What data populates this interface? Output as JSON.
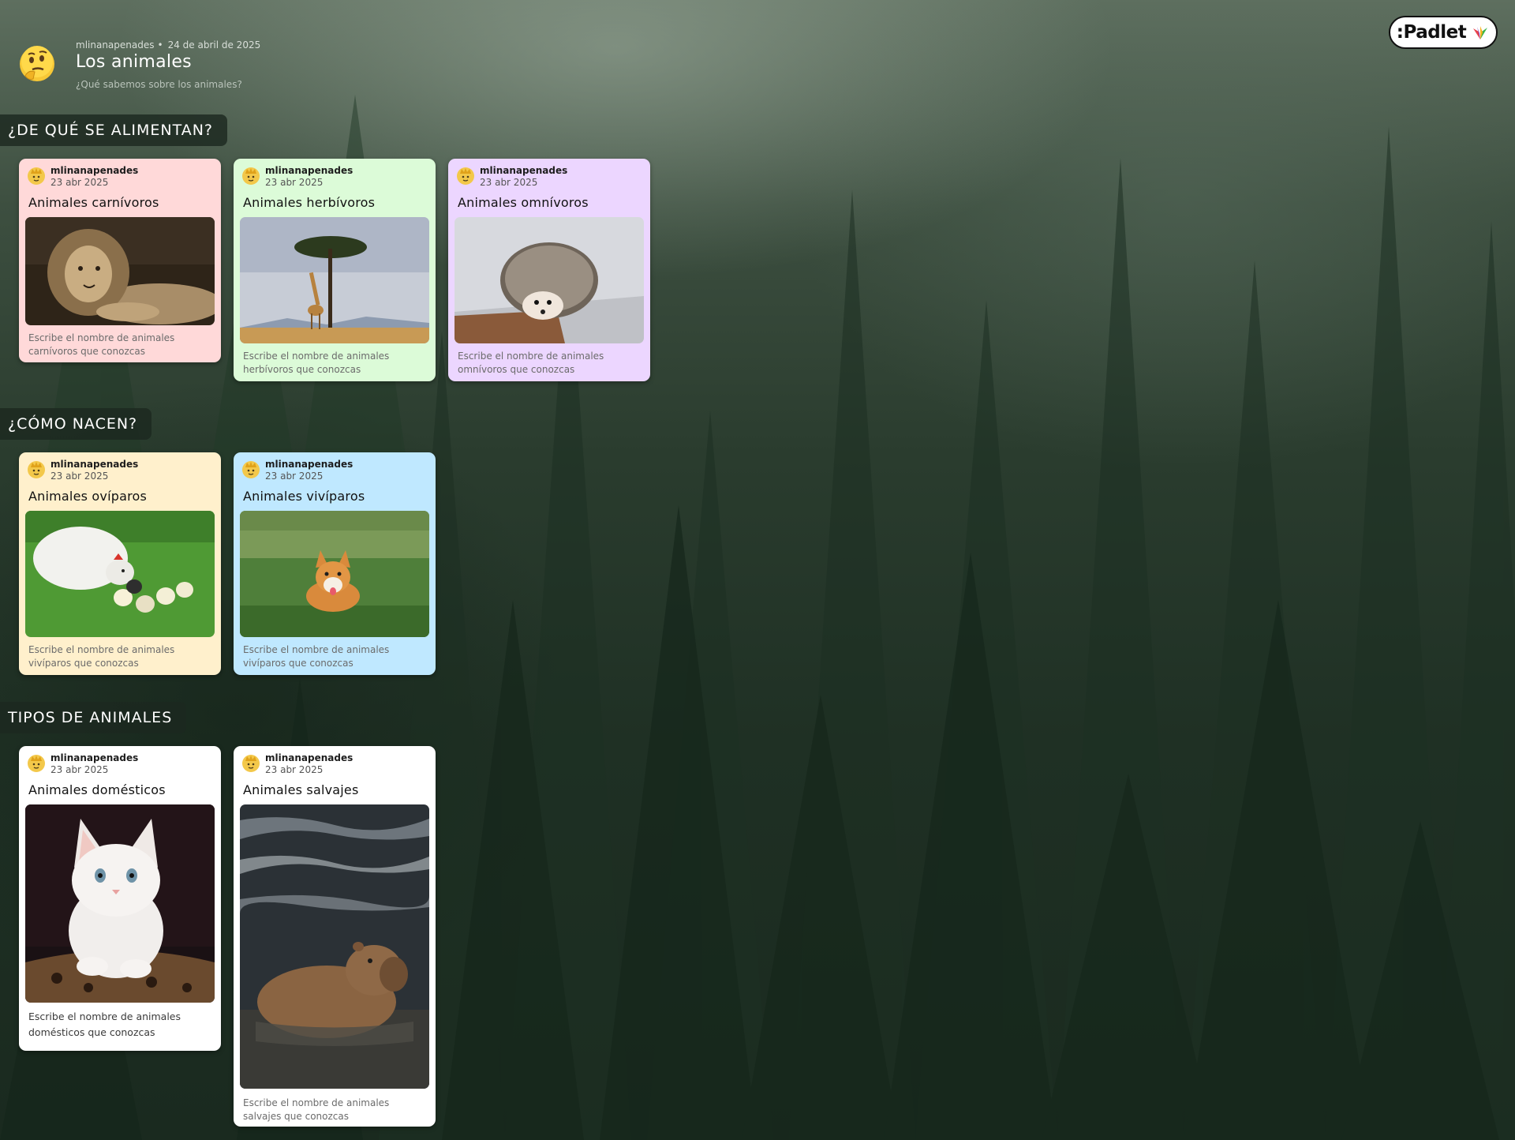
{
  "header": {
    "author": "mlinanapenades",
    "separator": "•",
    "date": "24 de abril de 2025",
    "title": "Los animales",
    "subtitle": "¿Qué sabemos sobre los animales?",
    "emoji_icon": "thinking-face-icon"
  },
  "logo": {
    "text": ":Padlet",
    "icon": "padlet-sprout-icon"
  },
  "sections": [
    {
      "title": "¿DE QUÉ SE ALIMENTAN?",
      "cards": [
        {
          "author": "mlinanapenades",
          "date": "23 abr 2025",
          "title": "Animales carnívoros",
          "image": "lion-photo",
          "body": "Escribe el nombre de animales carnívoros que conozcas",
          "color": "#ffd9d9"
        },
        {
          "author": "mlinanapenades",
          "date": "23 abr 2025",
          "title": "Animales herbívoros",
          "image": "giraffe-photo",
          "body": "Escribe el nombre de animales herbívoros que conozcas",
          "color": "#dcfbd8"
        },
        {
          "author": "mlinanapenades",
          "date": "23 abr 2025",
          "title": "Animales omnívoros",
          "image": "hedgehog-photo",
          "body": "Escribe el nombre de animales omnívoros que conozcas",
          "color": "#ecd6ff"
        }
      ]
    },
    {
      "title": "¿CÓMO NACEN?",
      "cards": [
        {
          "author": "mlinanapenades",
          "date": "23 abr 2025",
          "title": "Animales ovíparos",
          "image": "hen-chicks-photo",
          "body": "Escribe el nombre de animales vivíparos que conozcas",
          "color": "#fff0cc"
        },
        {
          "author": "mlinanapenades",
          "date": "23 abr 2025",
          "title": "Animales vivíparos",
          "image": "corgi-photo",
          "body": "Escribe el nombre de animales vivíparos que conozcas",
          "color": "#bfe8ff"
        }
      ]
    },
    {
      "title": "TIPOS DE ANIMALES",
      "cards": [
        {
          "author": "mlinanapenades",
          "date": "23 abr 2025",
          "title": "Animales domésticos",
          "image": "kitten-photo",
          "body": "Escribe el nombre de animales domésticos que conozcas",
          "color": "#ffffff"
        },
        {
          "author": "mlinanapenades",
          "date": "23 abr 2025",
          "title": "Animales salvajes",
          "image": "capybara-photo",
          "body": "Escribe el nombre de animales salvajes que conozcas",
          "color": "#ffffff"
        }
      ]
    }
  ]
}
